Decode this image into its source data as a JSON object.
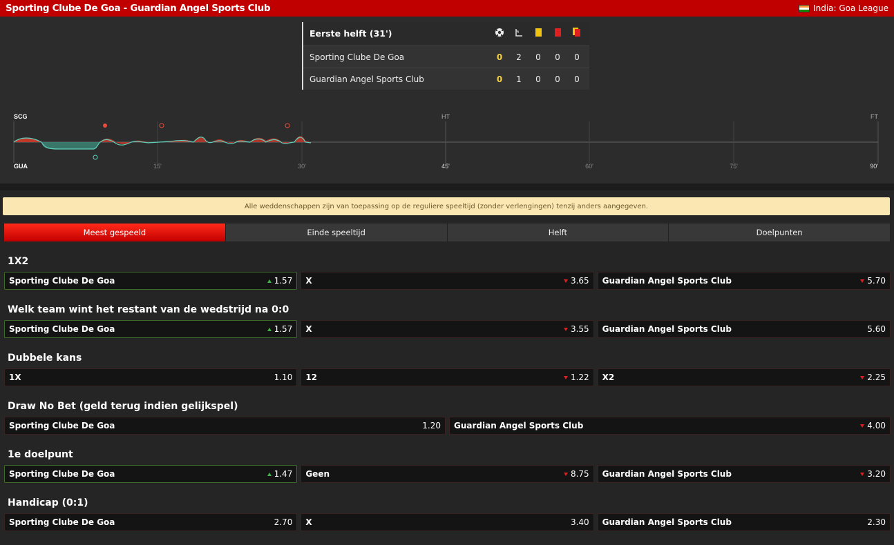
{
  "header": {
    "title": "Sporting Clube De Goa - Guardian Angel Sports Club",
    "league": "India: Goa League",
    "flag_colors": [
      "#ff9933",
      "#ffffff",
      "#138808"
    ]
  },
  "scoreboard": {
    "period": "Eerste helft (31')",
    "icons": [
      "ball-icon",
      "corner-icon",
      "yellow-card-icon",
      "red-card-icon",
      "yellow-red-card-icon"
    ],
    "teams": [
      {
        "name": "Sporting Clube De Goa",
        "goals": "0",
        "corners": "2",
        "yellow": "0",
        "red": "0",
        "yellowred": "0"
      },
      {
        "name": "Guardian Angel Sports Club",
        "goals": "0",
        "corners": "1",
        "yellow": "0",
        "red": "0",
        "yellowred": "0"
      }
    ]
  },
  "timeline": {
    "home_abbr": "SCG",
    "away_abbr": "GUA",
    "ht": "HT",
    "ft": "FT",
    "ticks": [
      "15'",
      "30'",
      "45'",
      "60'",
      "75'",
      "90'"
    ],
    "home_color": "#c0392b",
    "away_color": "#4fc3b0"
  },
  "notice": "Alle weddenschappen zijn van toepassing op de reguliere speeltijd (zonder verlengingen) tenzij anders aangegeven.",
  "tabs": [
    "Meest gespeeld",
    "Einde speeltijd",
    "Helft",
    "Doelpunten"
  ],
  "markets": [
    {
      "title": "1X2",
      "odds": [
        {
          "label": "Sporting Clube De Goa",
          "value": "1.57",
          "trend": "up"
        },
        {
          "label": "X",
          "value": "3.65",
          "trend": "down"
        },
        {
          "label": "Guardian Angel Sports Club",
          "value": "5.70",
          "trend": "down"
        }
      ]
    },
    {
      "title": "Welk team wint het restant van de wedstrijd na 0:0",
      "odds": [
        {
          "label": "Sporting Clube De Goa",
          "value": "1.57",
          "trend": "up"
        },
        {
          "label": "X",
          "value": "3.55",
          "trend": "down"
        },
        {
          "label": "Guardian Angel Sports Club",
          "value": "5.60",
          "trend": "none"
        }
      ]
    },
    {
      "title": "Dubbele kans",
      "odds": [
        {
          "label": "1X",
          "value": "1.10",
          "trend": "none"
        },
        {
          "label": "12",
          "value": "1.22",
          "trend": "down"
        },
        {
          "label": "X2",
          "value": "2.25",
          "trend": "down"
        }
      ]
    },
    {
      "title": "Draw No Bet (geld terug indien gelijkspel)",
      "odds": [
        {
          "label": "Sporting Clube De Goa",
          "value": "1.20",
          "trend": "none"
        },
        {
          "label": "Guardian Angel Sports Club",
          "value": "4.00",
          "trend": "down"
        }
      ]
    },
    {
      "title": "1e doelpunt",
      "odds": [
        {
          "label": "Sporting Clube De Goa",
          "value": "1.47",
          "trend": "up"
        },
        {
          "label": "Geen",
          "value": "8.75",
          "trend": "down"
        },
        {
          "label": "Guardian Angel Sports Club",
          "value": "3.20",
          "trend": "down"
        }
      ]
    },
    {
      "title": "Handicap (0:1)",
      "odds": [
        {
          "label": "Sporting Clube De Goa",
          "value": "2.70",
          "trend": "none"
        },
        {
          "label": "X",
          "value": "3.40",
          "trend": "none"
        },
        {
          "label": "Guardian Angel Sports Club",
          "value": "2.30",
          "trend": "none"
        }
      ]
    }
  ]
}
